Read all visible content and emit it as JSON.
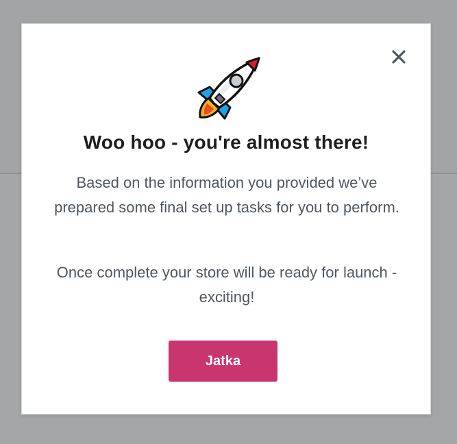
{
  "modal": {
    "title": "Woo hoo - you're almost there!",
    "paragraph_1": "Based on the information you provided we’ve prepared some final set up tasks for you to perform.",
    "paragraph_2": "Once complete your store will be ready for launch - exciting!",
    "button_label": "Jatka",
    "close_icon": "close-icon",
    "hero_icon": "rocket-icon"
  },
  "colors": {
    "button_bg": "#c9356e",
    "title_text": "#1e1e1e",
    "body_text": "#50575e",
    "overlay": "#a3a4a6"
  }
}
